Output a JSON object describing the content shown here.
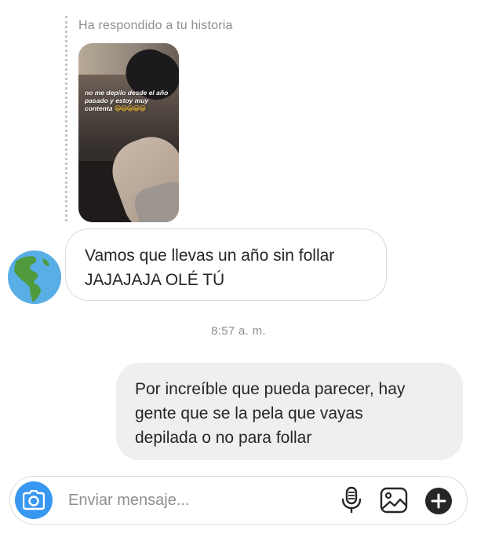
{
  "story_reply": {
    "label": "Ha respondido a tu historia",
    "caption": "no me depilo desde el año pasado y estoy muy contenta",
    "caption_emoji": "😁😁😁😁😁"
  },
  "messages": [
    {
      "direction": "incoming",
      "text_line1": "Vamos que llevas un año sin follar",
      "text_line2": "JAJAJAJA OLÉ TÚ",
      "avatar_icon": "globe-americas-icon"
    },
    {
      "direction": "outgoing",
      "text_line1": "Por increíble que pueda parecer, hay",
      "text_line2": "gente que se la pela que vayas",
      "text_line3": "depilada o no para follar"
    }
  ],
  "timestamp": "8:57 a. m.",
  "composer": {
    "placeholder": "Enviar mensaje...",
    "value": "",
    "icons": [
      "camera-icon",
      "microphone-icon",
      "image-icon",
      "plus-circle-icon"
    ],
    "accent_color": "#3897f0"
  }
}
